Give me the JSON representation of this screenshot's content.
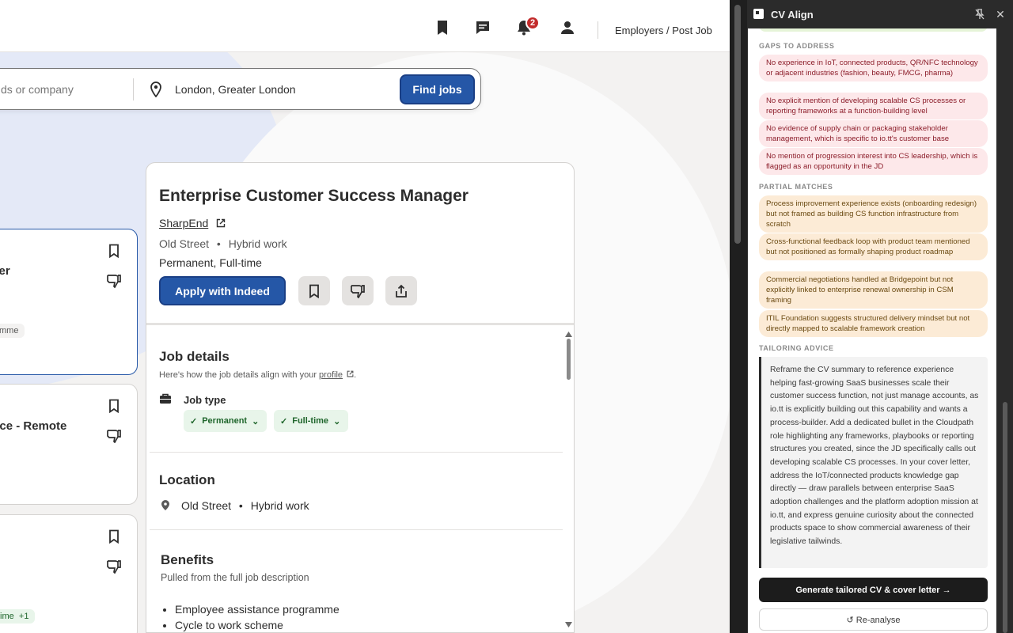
{
  "topbar": {
    "notification_count": "2",
    "employers_label": "Employers / Post Job",
    "icons": [
      "bookmark-icon",
      "messages-icon",
      "bell-icon",
      "user-icon"
    ]
  },
  "search": {
    "what_placeholder": "ds or company",
    "where_value": "London, Greater London",
    "find_label": "Find jobs"
  },
  "job_list": {
    "cards": [
      {
        "title": "ager",
        "pill": "mme"
      },
      {
        "title": "rvice - Remote",
        "pill": ""
      },
      {
        "title": "",
        "pill": "time",
        "pill_count": "+1"
      }
    ]
  },
  "job": {
    "title": "Enterprise Customer Success Manager",
    "company": "SharpEnd",
    "location": "Old Street",
    "work_mode": "Hybrid work",
    "job_types": "Permanent, Full-time",
    "apply_label": "Apply with Indeed",
    "details_heading": "Job details",
    "details_sub_prefix": "Here's how the job details align with your",
    "details_sub_link": "profile",
    "job_type_label": "Job type",
    "chips": [
      "Permanent",
      "Full-time"
    ],
    "location_heading": "Location",
    "benefits_heading": "Benefits",
    "benefits_sub": "Pulled from the full job description",
    "benefits": [
      "Employee assistance programme",
      "Cycle to work scheme"
    ]
  },
  "ext": {
    "name": "CV Align",
    "gaps_label": "GAPS TO ADDRESS",
    "gaps": [
      "No experience in IoT, connected products, QR/NFC technology or adjacent industries (fashion, beauty, FMCG, pharma)",
      "No explicit mention of developing scalable CS processes or reporting frameworks at a function-building level",
      "No evidence of supply chain or packaging stakeholder management, which is specific to io.tt's customer base",
      "No mention of progression interest into CS leadership, which is flagged as an opportunity in the JD"
    ],
    "partial_label": "PARTIAL MATCHES",
    "partial": [
      "Process improvement experience exists (onboarding redesign) but not framed as building CS function infrastructure from scratch",
      "Cross-functional feedback loop with product team mentioned but not positioned as formally shaping product roadmap",
      "Commercial negotiations handled at Bridgepoint but not explicitly linked to enterprise renewal ownership in CSM framing",
      "ITIL Foundation suggests structured delivery mindset but not directly mapped to scalable framework creation"
    ],
    "advice_label": "TAILORING ADVICE",
    "advice": "Reframe the CV summary to reference experience helping fast-growing SaaS businesses scale their customer success function, not just manage accounts, as io.tt is explicitly building out this capability and wants a process-builder. Add a dedicated bullet in the Cloudpath role highlighting any frameworks, playbooks or reporting structures you created, since the JD specifically calls out developing scalable CS processes. In your cover letter, address the IoT/connected products knowledge gap directly — draw parallels between enterprise SaaS adoption challenges and the platform adoption mission at io.tt, and express genuine curiosity about the connected products space to show commercial awareness of their legislative tailwinds.",
    "generate_label": "Generate tailored CV & cover letter →",
    "reanalyse_label": "↺ Re-analyse"
  }
}
